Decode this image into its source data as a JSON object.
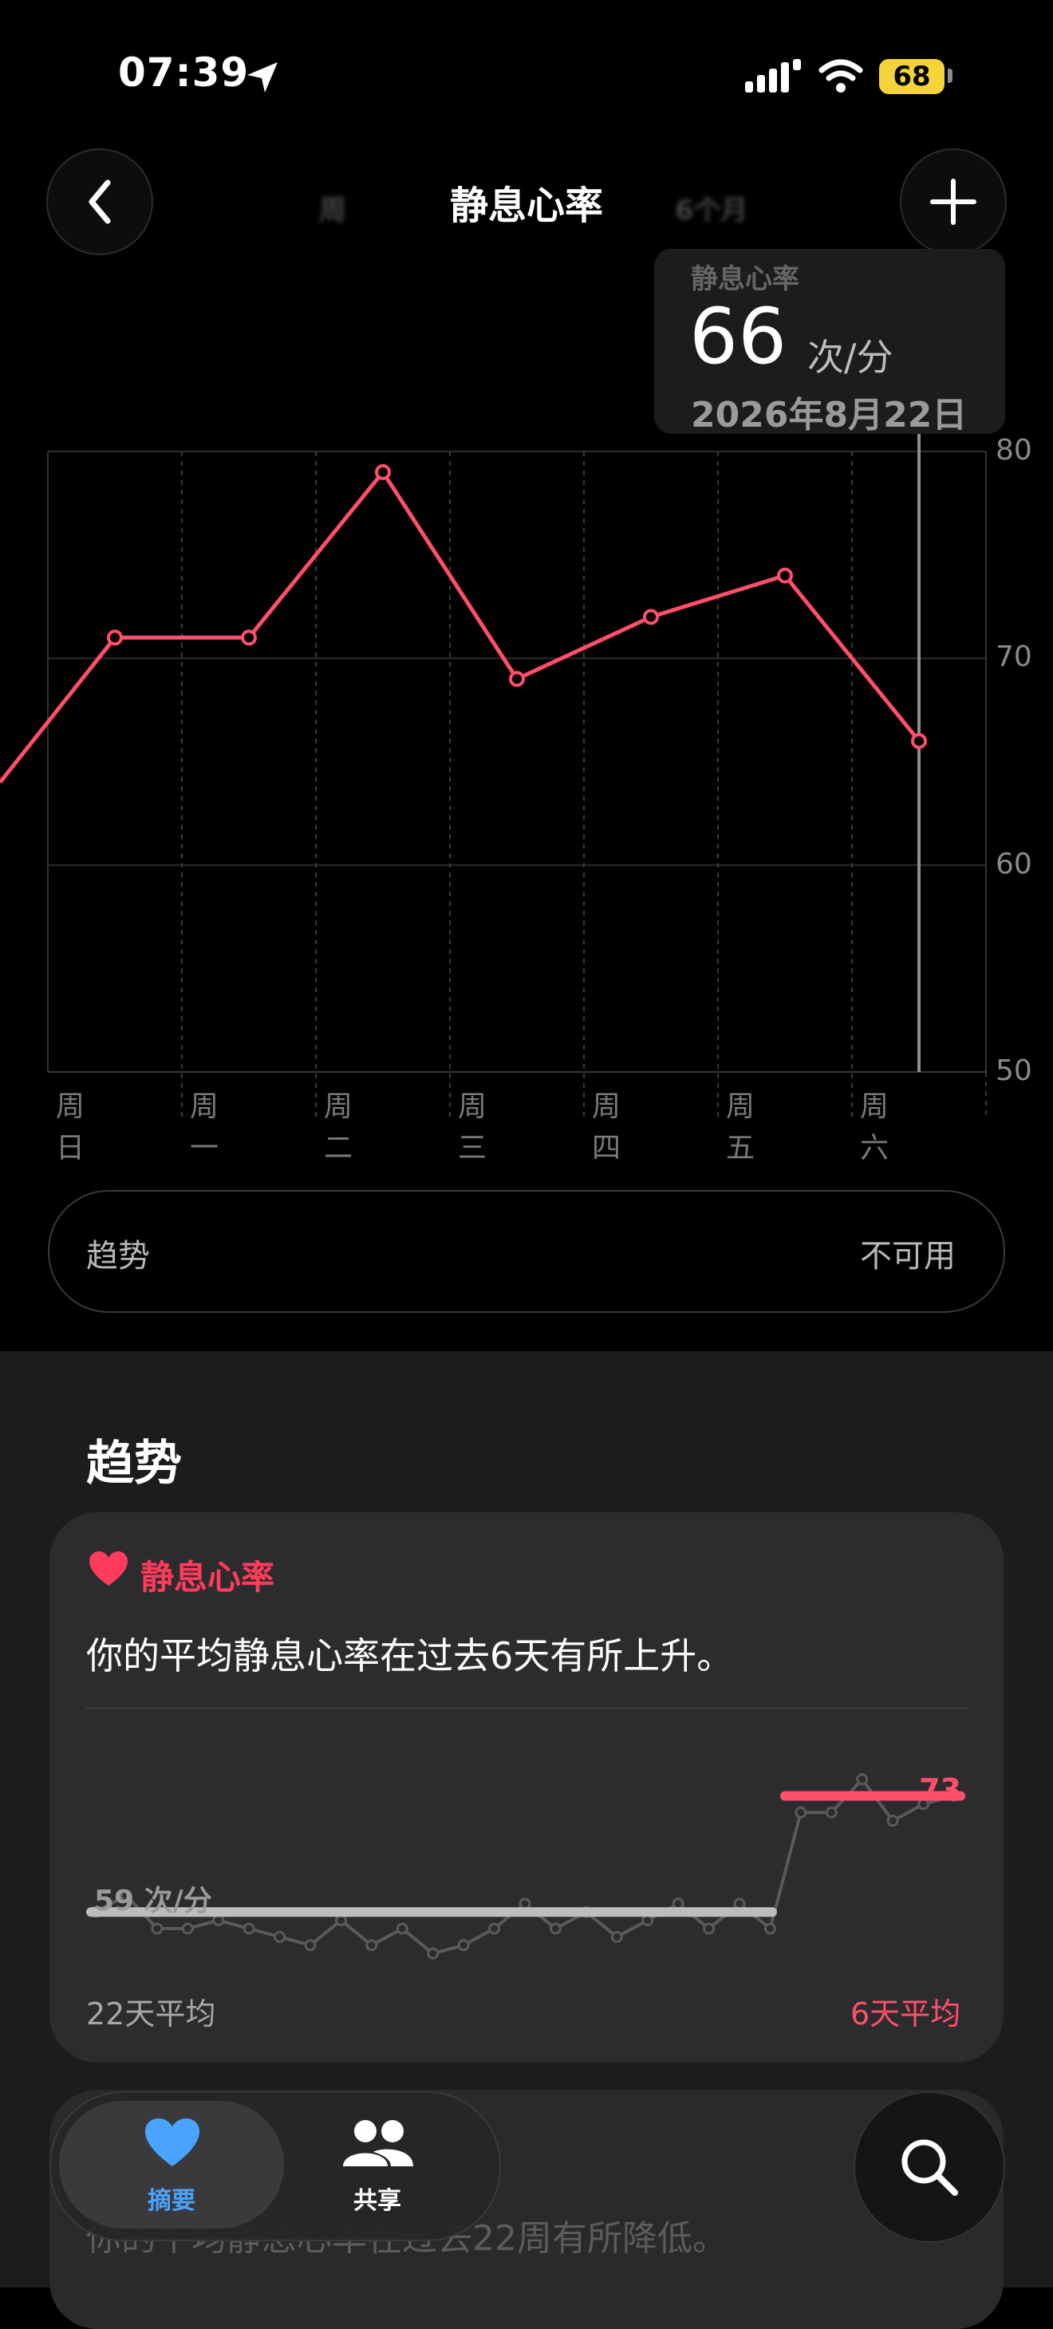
{
  "status": {
    "time": "07:39",
    "battery": "68"
  },
  "nav": {
    "title": "静息心率",
    "segments_hidden": [
      "周",
      "6个月"
    ]
  },
  "tooltip": {
    "label": "静息心率",
    "value": "66",
    "unit": "次/分",
    "date": "2026年8月22日"
  },
  "chart_data": {
    "type": "line",
    "categories": [
      "周日",
      "周一",
      "周二",
      "周三",
      "周四",
      "周五",
      "周六"
    ],
    "series": [
      {
        "values": [
          71,
          71,
          79,
          69,
          72,
          74,
          66
        ]
      }
    ],
    "ylim": [
      50,
      80
    ],
    "yticks": [
      "80",
      "70",
      "60",
      "50"
    ],
    "highlight_category": "周六",
    "color": "#ff4f69"
  },
  "trend_pill": {
    "label": "趋势",
    "status": "不可用"
  },
  "trends": {
    "title": "趋势",
    "card": {
      "heading": "静息心率",
      "text": "你的平均静息心率在过去6天有所上升。",
      "old_avg_label": "59 次/分",
      "new_avg_label": "73",
      "foot_left": "22天平均",
      "foot_right": "6天平均",
      "sparkline_values": [
        59,
        61,
        57,
        57,
        58,
        57,
        56,
        55,
        58,
        55,
        57,
        54,
        55,
        57,
        60,
        57,
        59,
        56,
        58,
        60,
        57,
        60,
        57,
        71,
        71,
        75,
        70,
        72,
        73
      ]
    },
    "card2_text": "你的平均静息心率在过去22周有所降低。"
  },
  "tabbar": {
    "tabs": [
      {
        "label": "摘要",
        "active": true
      },
      {
        "label": "共享",
        "active": false
      }
    ]
  },
  "colors": {
    "accent": "#ff4f69",
    "active_tab": "#4aa3ff"
  }
}
